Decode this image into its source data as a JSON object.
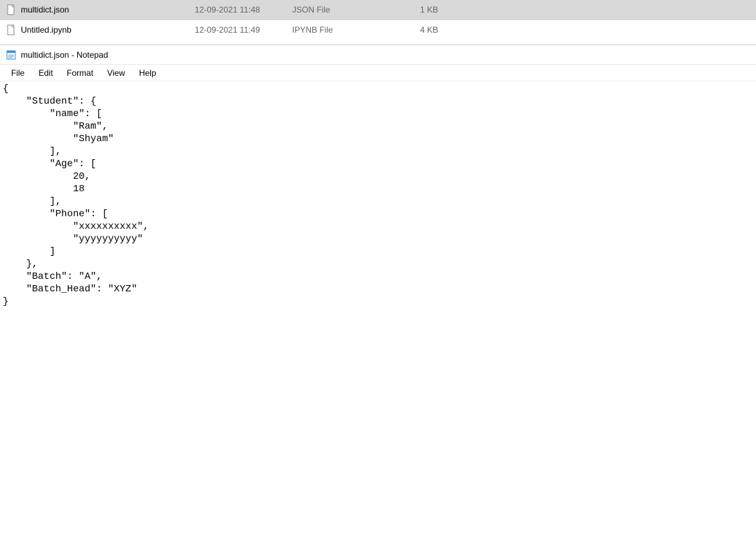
{
  "files": [
    {
      "name": "multidict.json",
      "date": "12-09-2021 11:48",
      "type": "JSON File",
      "size": "1 KB",
      "selected": true
    },
    {
      "name": "Untitled.ipynb",
      "date": "12-09-2021 11:49",
      "type": "IPYNB File",
      "size": "4 KB",
      "selected": false
    }
  ],
  "notepad": {
    "title": "multidict.json - Notepad",
    "menus": {
      "file": "File",
      "edit": "Edit",
      "format": "Format",
      "view": "View",
      "help": "Help"
    },
    "content": "{\n    \"Student\": {\n        \"name\": [\n            \"Ram\",\n            \"Shyam\"\n        ],\n        \"Age\": [\n            20,\n            18\n        ],\n        \"Phone\": [\n            \"xxxxxxxxxx\",\n            \"yyyyyyyyyy\"\n        ]\n    },\n    \"Batch\": \"A\",\n    \"Batch_Head\": \"XYZ\"\n}"
  }
}
